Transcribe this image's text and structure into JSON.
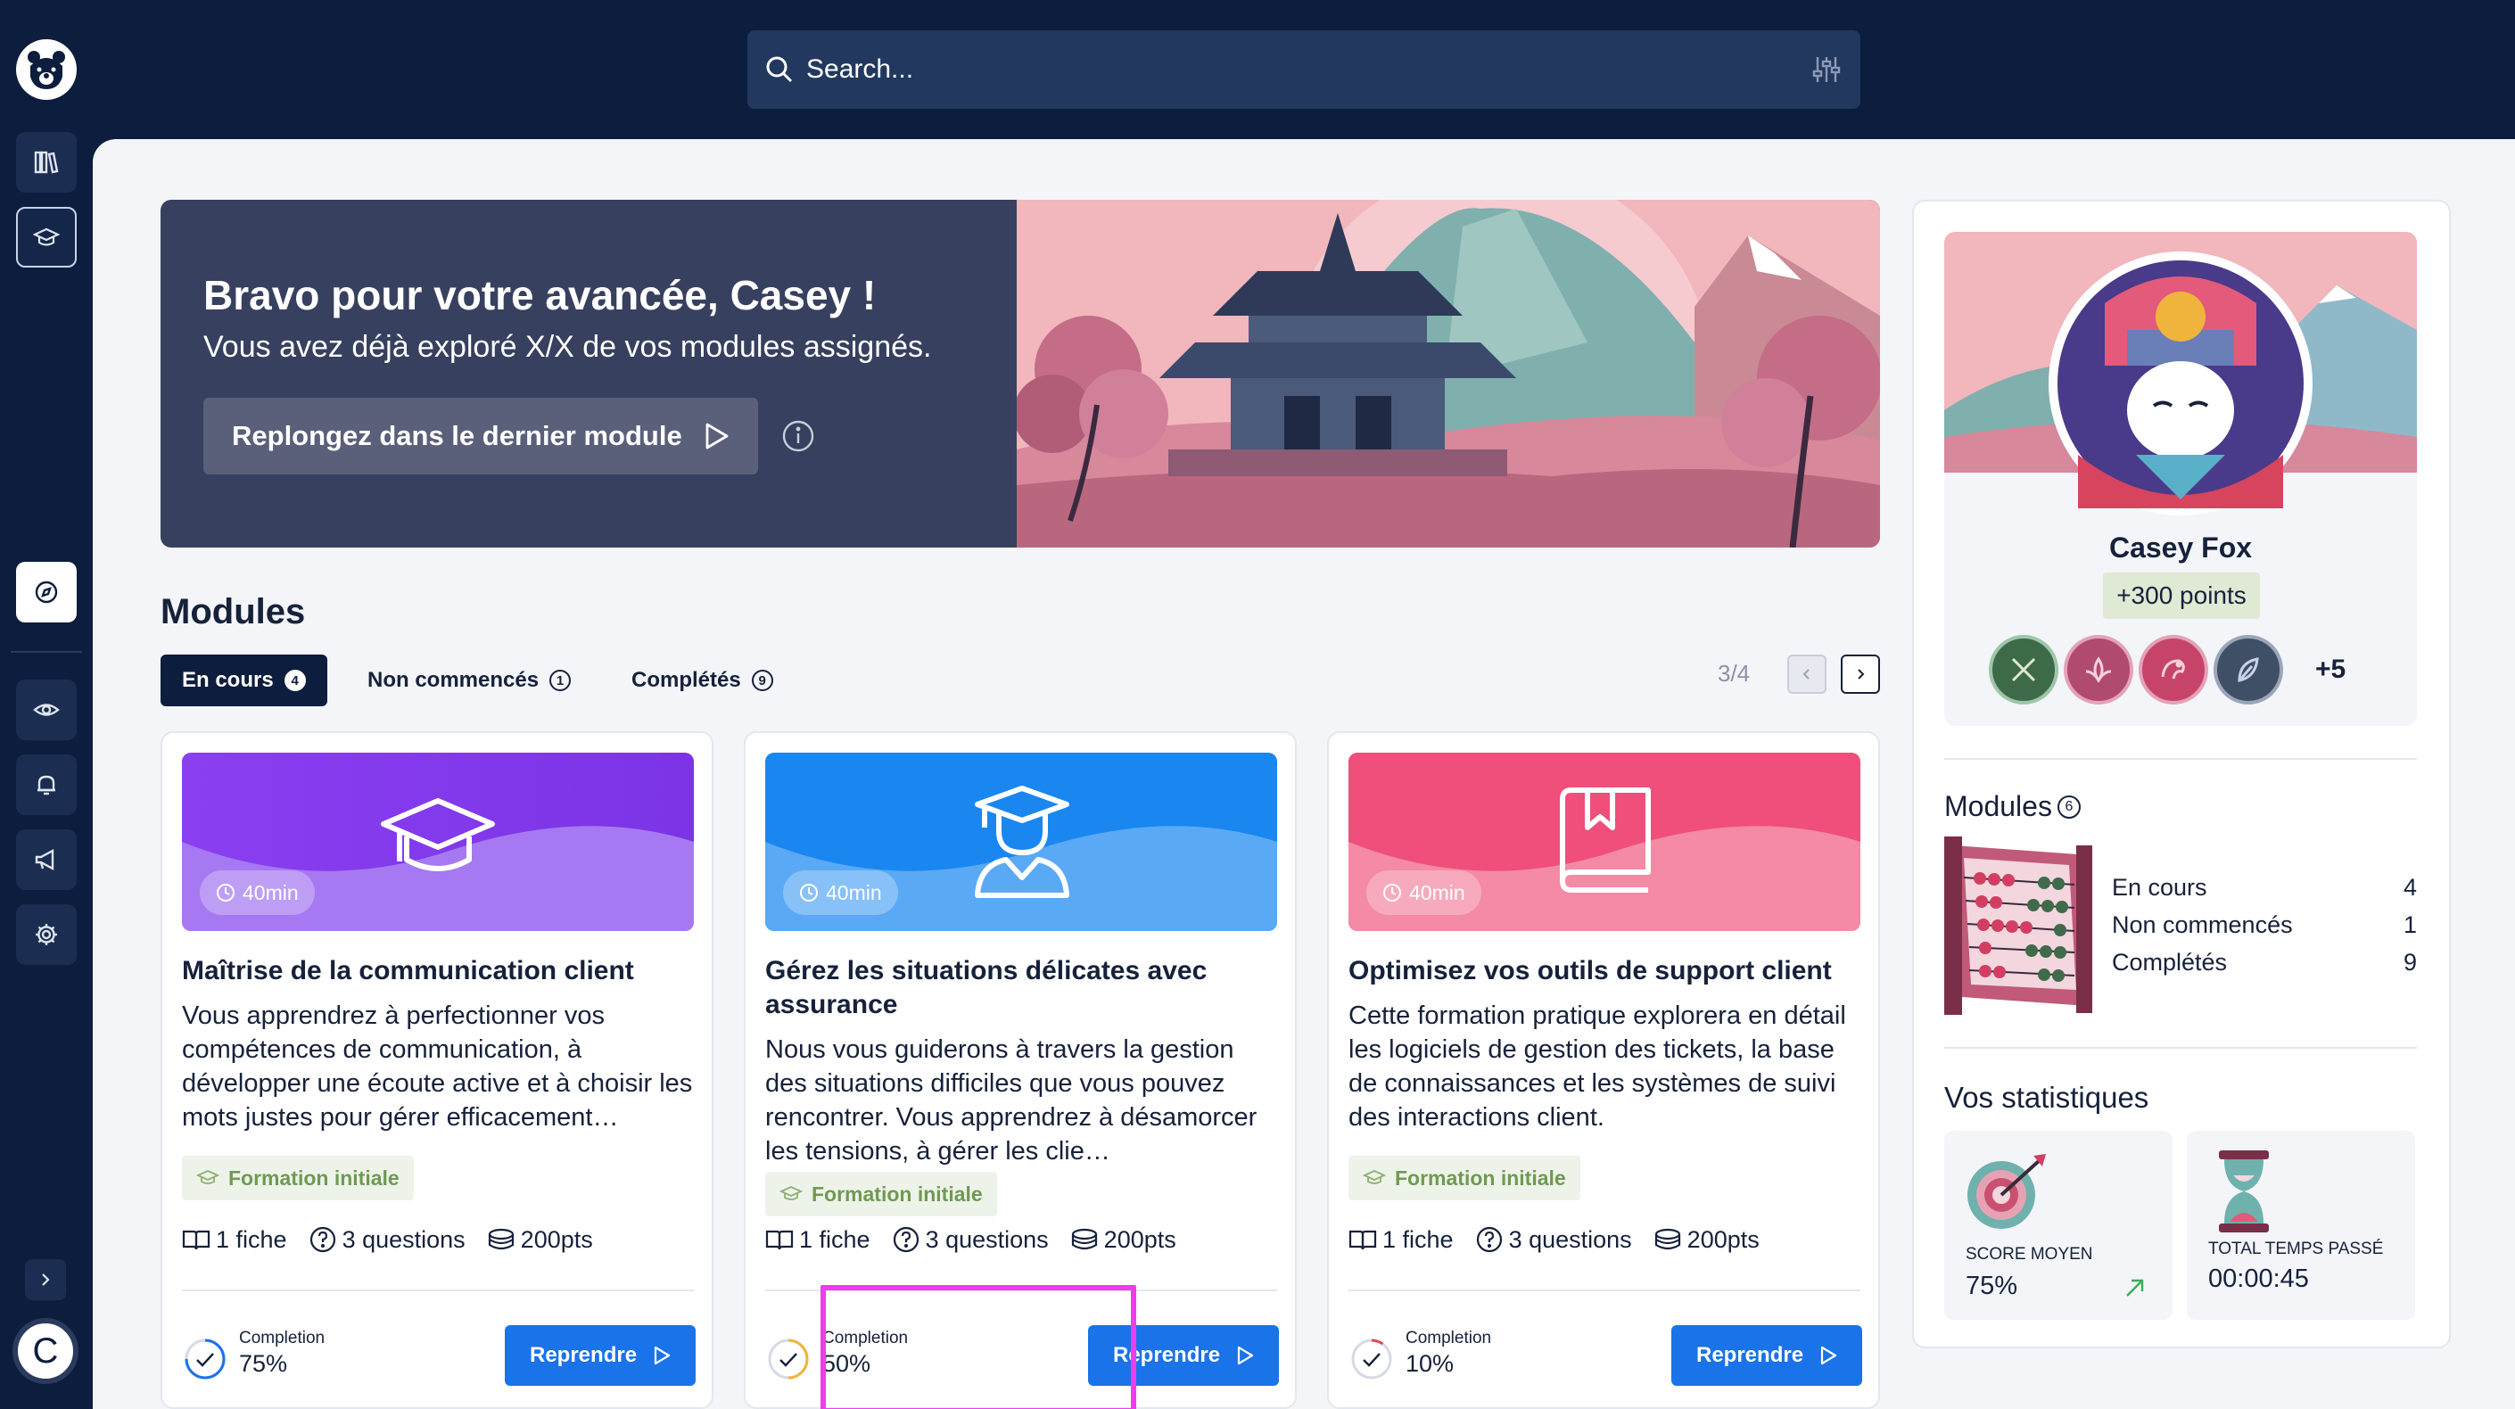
{
  "search": {
    "placeholder": "Search..."
  },
  "user": {
    "initial": "C"
  },
  "hero": {
    "title": "Bravo pour votre avancée, Casey !",
    "subtitle": "Vous avez déjà exploré X/X de vos modules assignés.",
    "cta_label": "Replongez dans le dernier module"
  },
  "modules": {
    "title": "Modules",
    "tabs": [
      {
        "label": "En cours",
        "count": "4"
      },
      {
        "label": "Non commencés",
        "count": "1"
      },
      {
        "label": "Complétés",
        "count": "9"
      }
    ],
    "pager": "3/4",
    "cards": [
      {
        "duration": "40min",
        "title": "Maîtrise de la communication client",
        "description": "Vous apprendrez à perfectionner vos compétences de communication, à développer une écoute active et à choisir les mots justes pour gérer efficacement…",
        "tag": "Formation initiale",
        "sheets": "1 fiche",
        "questions": "3 questions",
        "points": "200pts",
        "completion_label": "Completion",
        "completion": "75%",
        "completion_value": 0.75,
        "ring_color": "#1a73e8",
        "resume_label": "Reprendre"
      },
      {
        "duration": "40min",
        "title": "Gérez les situations délicates avec assurance",
        "description": "Nous vous guiderons à travers la gestion des situations difficiles que vous pouvez rencontrer. Vous apprendrez à désamorcer les tensions, à gérer les clie…",
        "tag": "Formation initiale",
        "sheets": "1 fiche",
        "questions": "3 questions",
        "points": "200pts",
        "completion_label": "Completion",
        "completion": "50%",
        "completion_value": 0.5,
        "ring_color": "#f0b43c",
        "resume_label": "Reprendre"
      },
      {
        "duration": "40min",
        "title": "Optimisez vos outils de support client",
        "description": "Cette formation pratique explorera en détail les logiciels de gestion des tickets, la base de connaissances et les systèmes de suivi des interactions client.",
        "tag": "Formation initiale",
        "sheets": "1 fiche",
        "questions": "3 questions",
        "points": "200pts",
        "completion_label": "Completion",
        "completion": "10%",
        "completion_value": 0.1,
        "ring_color": "#e8455a",
        "resume_label": "Reprendre"
      }
    ]
  },
  "profile": {
    "name": "Casey Fox",
    "points": "+300 points",
    "more_badges": "+5",
    "modules_title": "Modules",
    "modules_count": "6",
    "module_stats": [
      {
        "label": "En cours",
        "value": "4"
      },
      {
        "label": "Non commencés",
        "value": "1"
      },
      {
        "label": "Complétés",
        "value": "9"
      }
    ],
    "stats_title": "Vos statistiques",
    "stats": [
      {
        "label": "Score  moyen",
        "value": "75%"
      },
      {
        "label": "Total temps passé",
        "value": "00:00:45"
      }
    ]
  }
}
